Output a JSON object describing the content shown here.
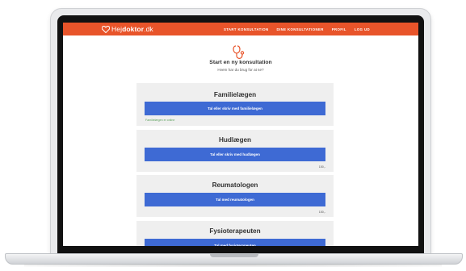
{
  "header": {
    "brand_prefix": "Hej",
    "brand_suffix": "doktor",
    "brand_tld": ".dk",
    "nav": [
      {
        "label": "START KONSULTATION"
      },
      {
        "label": "DINE KONSULTATIONER"
      },
      {
        "label": "PROFIL"
      },
      {
        "label": "LOG UD"
      }
    ]
  },
  "intro": {
    "title": "Start en ny konsultation",
    "subtitle": "Hvem har du brug for at se?"
  },
  "cards": [
    {
      "title": "Familielægen",
      "button": "Tal eller skriv med familielægen",
      "note": "Familielægen er online",
      "price": ""
    },
    {
      "title": "Hudlægen",
      "button": "Tal eller skriv med hudlægen",
      "note": "",
      "price": "150,-"
    },
    {
      "title": "Reumatologen",
      "button": "Tal med reumatologen",
      "note": "",
      "price": "150,-"
    },
    {
      "title": "Fysioterapeuten",
      "button": "Tal med fysioterapeuten",
      "note": "",
      "price": ""
    }
  ],
  "colors": {
    "brand": "#e8542a",
    "button": "#3e6ad4",
    "card_bg": "#efefef",
    "online": "#5aa05a"
  },
  "icons": {
    "logo": "heart-icon",
    "intro": "stethoscope-icon"
  }
}
